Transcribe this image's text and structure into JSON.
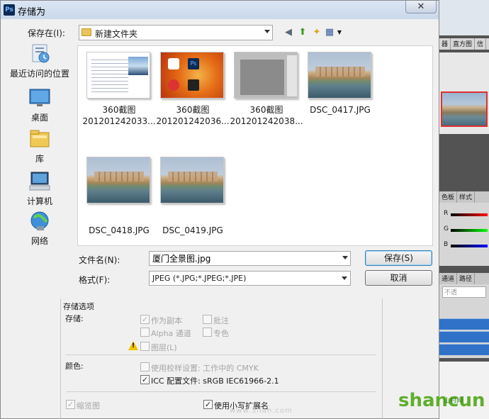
{
  "dialog": {
    "title": "存储为",
    "close_symbol": "✕"
  },
  "toolbar": {
    "save_in_label": "保存在(I):",
    "current_folder": "新建文件夹"
  },
  "places": [
    {
      "label": "最近访问的位置",
      "icon": "recent-places-icon"
    },
    {
      "label": "桌面",
      "icon": "desktop-icon"
    },
    {
      "label": "库",
      "icon": "libraries-icon"
    },
    {
      "label": "计算机",
      "icon": "computer-icon"
    },
    {
      "label": "网络",
      "icon": "network-icon"
    }
  ],
  "files": [
    {
      "name": "360截图",
      "name2": "201201242033...",
      "kind": "doc"
    },
    {
      "name": "360截图",
      "name2": "201201242036...",
      "kind": "orange"
    },
    {
      "name": "360截图",
      "name2": "201201242038...",
      "kind": "gray"
    },
    {
      "name": "DSC_0417.JPG",
      "name2": "",
      "kind": "photo"
    },
    {
      "name": "DSC_0418.JPG",
      "name2": "",
      "kind": "photo"
    },
    {
      "name": "DSC_0419.JPG",
      "name2": "",
      "kind": "photo"
    }
  ],
  "form": {
    "filename_label": "文件名(N):",
    "filename_value": "厦门全景图.jpg",
    "format_label": "格式(F):",
    "format_value": "JPEG (*.JPG;*.JPEG;*.JPE)",
    "save_button": "保存(S)",
    "cancel_button": "取消"
  },
  "options": {
    "title": "存储选项",
    "storage_label": "存储:",
    "as_copy": "作为副本",
    "annotations": "批注",
    "alpha": "Alpha 通道",
    "spot": "专色",
    "layers": "图层(L)",
    "color_label": "颜色:",
    "use_proof": "使用校样设置: 工作中的 CMYK",
    "icc": "ICC 配置文件: sRGB IEC61966-2.1",
    "thumbnail": "缩览图",
    "lowercase_ext": "使用小写扩展名"
  },
  "background_app": {
    "tabs_top": [
      "器",
      "直方图",
      "信"
    ],
    "tabs_mid": [
      "色板",
      "样式"
    ],
    "channels": [
      "R",
      "G",
      "B"
    ],
    "tabs_low": [
      "通道",
      "路径"
    ],
    "opacity_placeholder": "不透",
    "logo_text": "shancun",
    "logo_sub": "山村网",
    "watermark": "www.3lian.com"
  },
  "colors": {
    "accent_blue": "#2f72c8",
    "title_grad": "#c9d8ea",
    "logo_green": "#5fae2b"
  }
}
